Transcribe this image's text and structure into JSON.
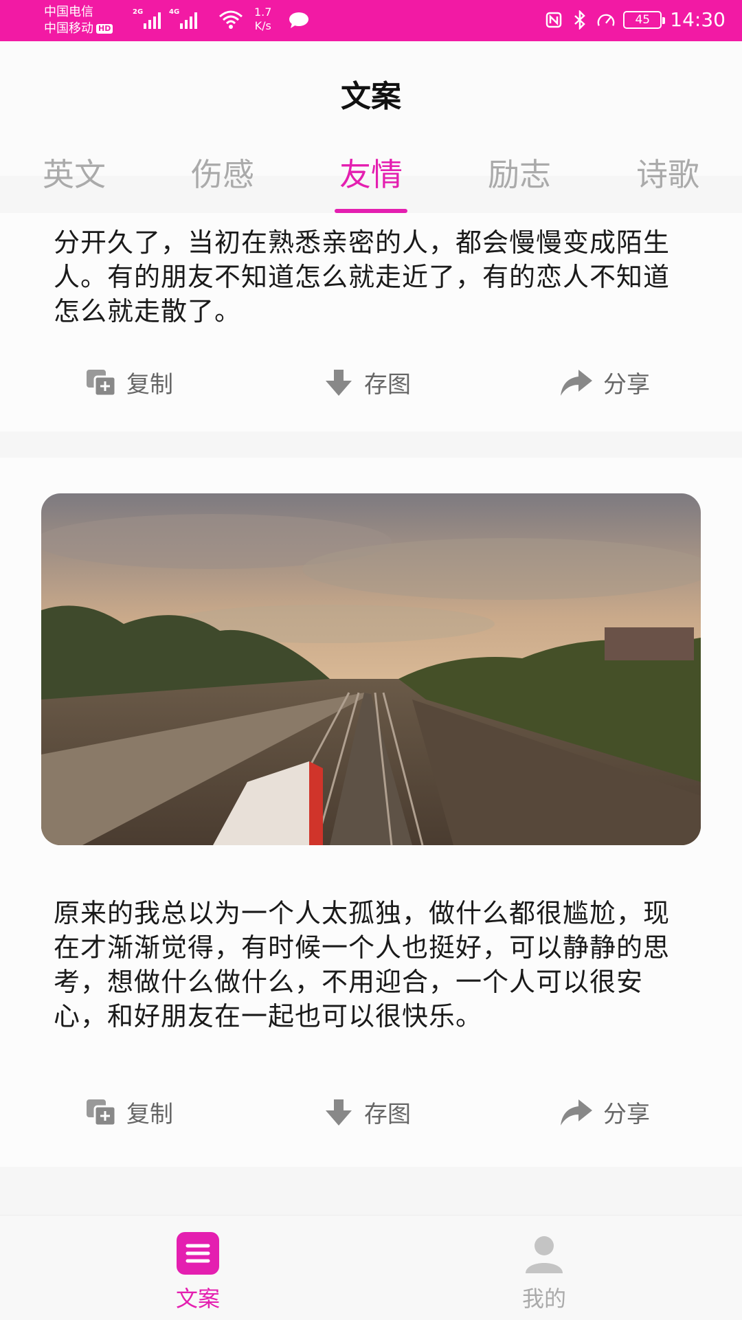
{
  "status_bar": {
    "carrier1": "中国电信",
    "carrier2": "中国移动",
    "hd_badge": "HD",
    "sim1_tag": "2G",
    "sim2_tag": "4G",
    "net_speed_value": "1.7",
    "net_speed_unit": "K/s",
    "battery_level": "45",
    "time": "14:30",
    "icons": [
      "nfc-icon",
      "bluetooth-icon",
      "speedometer-icon"
    ]
  },
  "header": {
    "title": "文案",
    "tabs": [
      "英文",
      "伤感",
      "友情",
      "励志",
      "诗歌"
    ],
    "active_tab_index": 2,
    "accent_color": "#e41fb0"
  },
  "cards": [
    {
      "text": "分开久了，当初在熟悉亲密的人，都会慢慢变成陌生人。有的朋友不知道怎么就走近了，有的恋人不知道怎么就走散了。",
      "actions": {
        "copy": "复制",
        "save_image": "存图",
        "share": "分享"
      }
    },
    {
      "image": "railway-at-sunset-photo",
      "text": "原来的我总以为一个人太孤独，做什么都很尴尬，现在才渐渐觉得，有时候一个人也挺好，可以静静的思考，想做什么做什么，不用迎合，一个人可以很安心，和好朋友在一起也可以很快乐。",
      "actions": {
        "copy": "复制",
        "save_image": "存图",
        "share": "分享"
      }
    }
  ],
  "bottom_nav": [
    {
      "label": "文案",
      "icon": "document-list-icon",
      "active": true
    },
    {
      "label": "我的",
      "icon": "user-profile-icon",
      "active": false
    }
  ]
}
